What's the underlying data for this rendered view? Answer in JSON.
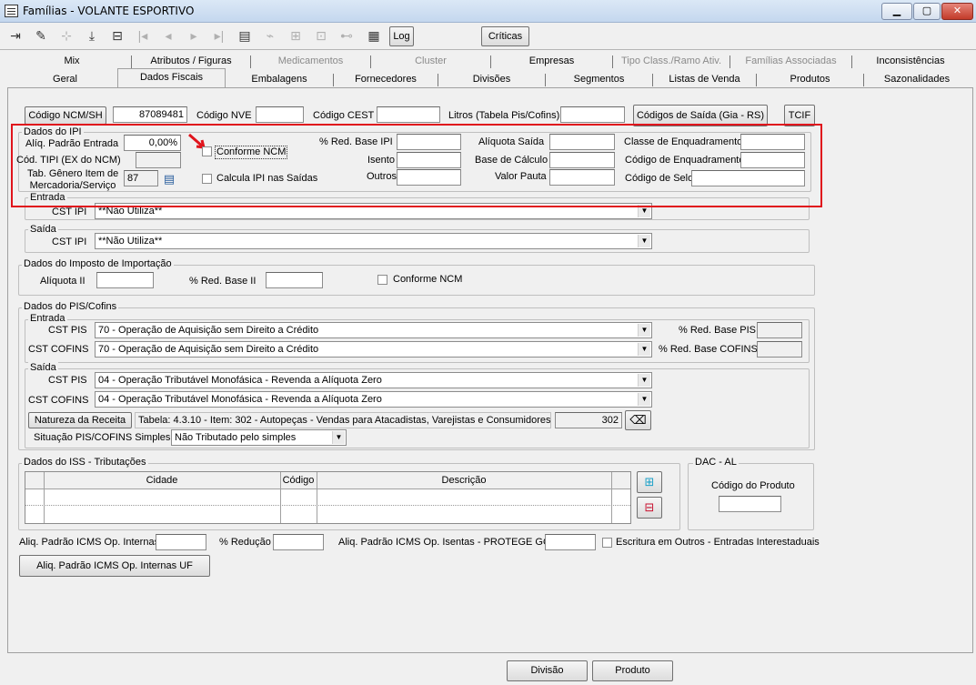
{
  "window": {
    "title": "Famílias - VOLANTE ESPORTIVO",
    "minimize": "▁",
    "maximize": "▢",
    "close": "✕"
  },
  "toolbar": {
    "log": "Log",
    "criticas": "Críticas"
  },
  "tabs": {
    "row1": [
      "Mix",
      "Atributos / Figuras",
      "Medicamentos",
      "Cluster",
      "Empresas",
      "Tipo Class./Ramo Ativ.",
      "Famílias Associadas",
      "Inconsistências"
    ],
    "row2": [
      "Geral",
      "Dados Fiscais",
      "Embalagens",
      "Fornecedores",
      "Divisões",
      "Segmentos",
      "Listas de Venda",
      "Produtos",
      "Sazonalidades"
    ]
  },
  "top": {
    "ncm_label": "Código NCM/SH",
    "ncm_value": "87089481",
    "nve_label": "Código NVE",
    "cest_label": "Código CEST",
    "litros_label": "Litros (Tabela Pis/Cofins)",
    "codigos_saida_button": "Códigos de Saída (Gia - RS)",
    "tcif_button": "TCIF"
  },
  "ipi": {
    "caption": "Dados do IPI",
    "aliq_label": "Alíq. Padrão Entrada",
    "aliq_value": "0,00%",
    "conforme_label": "Conforme NCM",
    "tipi_label": "Cód. TIPI (EX do NCM)",
    "genero_label1": "Tab. Gênero Item de",
    "genero_label2": "Mercadoria/Serviço",
    "genero_value": "87",
    "calcula_label": "Calcula IPI nas Saídas",
    "red_label": "% Red. Base IPI",
    "isento_label": "Isento",
    "outros_label": "Outros",
    "aliq_saida_label": "Alíquota Saída",
    "base_label": "Base de Cálculo",
    "pauta_label": "Valor Pauta",
    "classe_label": "Classe de Enquadramento",
    "codenq_label": "Código de Enquadramento",
    "selo_label": "Código de Selo"
  },
  "ipi_entrada": {
    "caption": "Entrada",
    "cst_label": "CST IPI",
    "cst_value": "**Não Utiliza**"
  },
  "ipi_saida": {
    "caption": "Saída",
    "cst_label": "CST IPI",
    "cst_value": "**Não Utiliza**"
  },
  "importacao": {
    "caption": "Dados do Imposto de Importação",
    "aliq_label": "Alíquota II",
    "red_label": "% Red. Base II",
    "conforme_label": "Conforme NCM"
  },
  "pis": {
    "caption": "Dados do PIS/Cofins",
    "entrada_caption": "Entrada",
    "cst_pis_label": "CST PIS",
    "cst_pis_value": "70 - Operação de Aquisição sem Direito a Crédito",
    "cst_cofins_label": "CST COFINS",
    "cst_cofins_value": "70 - Operação de Aquisição sem Direito a Crédito",
    "red_pis_label": "% Red. Base PIS",
    "red_cofins_label": "% Red. Base COFINS",
    "saida_caption": "Saída",
    "s_cst_pis_label": "CST PIS",
    "s_cst_pis_value": "04 - Operação Tributável Monofásica - Revenda a Alíquota Zero",
    "s_cst_cofins_label": "CST COFINS",
    "s_cst_cofins_value": "04 - Operação Tributável Monofásica - Revenda a Alíquota Zero",
    "natureza_button": "Natureza da Receita",
    "natureza_text": "Tabela: 4.3.10 - Item: 302 - Autopeças - Vendas para Atacadistas, Varejistas e Consumidores",
    "natureza_code": "302",
    "situacao_label": "Situação PIS/COFINS Simples",
    "situacao_value": "Não Tributado pelo simples"
  },
  "iss": {
    "caption": "Dados do ISS - Tributações",
    "columns": [
      "Cidade",
      "Código",
      "Descrição"
    ]
  },
  "dac": {
    "caption": "DAC - AL",
    "codigo_label": "Código do Produto"
  },
  "bottom": {
    "icms_label": "Aliq. Padrão ICMS Op. Internas",
    "reducao_label": "% Redução",
    "isentas_label": "Aliq. Padrão ICMS Op. Isentas - PROTEGE GO",
    "escritura_label": "Escritura em Outros - Entradas Interestaduais",
    "uf_button": "Aliq. Padrão ICMS Op. Internas UF",
    "divisao_button": "Divisão",
    "produto_button": "Produto"
  },
  "colors": {
    "highlight": "#e0141c",
    "arrow": "#e0141c"
  }
}
